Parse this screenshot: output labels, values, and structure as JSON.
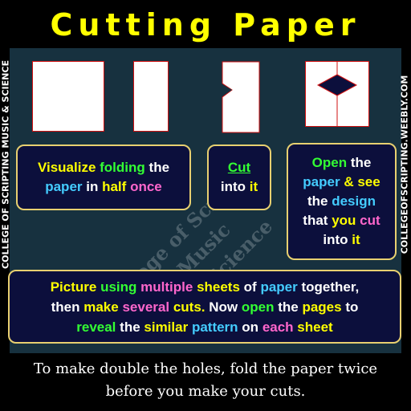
{
  "title": "Cutting Paper",
  "side_left": "COLLEGE OF SCRIPTING MUSIC & SCIENCE",
  "side_right": "COLLEGEOFSCRIPTING.WEEBLY.COM",
  "watermark": {
    "line1": "College of Scripting Music",
    "line2": "and Science"
  },
  "step1": {
    "w1": "Visualize",
    "w2": "folding",
    "w3": "the",
    "w4": "paper",
    "w5": "in",
    "w6": "half",
    "w7": "once"
  },
  "step2": {
    "w1": "Cut",
    "w2": "into",
    "w3": "it"
  },
  "step3": {
    "w1": "Open",
    "w2": "the",
    "w3": "paper",
    "w4": "&",
    "w5": "see",
    "w6": "the",
    "w7": "design",
    "w8": "that",
    "w9": "you",
    "w10": "cut",
    "w11": "into",
    "w12": "it"
  },
  "step4": {
    "w1": "Picture",
    "w2": "using",
    "w3": "multiple",
    "w4": "sheets",
    "w5": "of",
    "w6": "paper",
    "w7": "together,",
    "w8": "then",
    "w9": "make",
    "w10": "several",
    "w11": "cuts.",
    "w12": "Now",
    "w13": "open",
    "w14": "the",
    "w15": "pages",
    "w16": "to",
    "w17": "reveal",
    "w18": "the",
    "w19": "similar",
    "w20": "pattern",
    "w21": "on",
    "w22": "each",
    "w23": "sheet"
  },
  "caption": {
    "line1": "To make double the holes, fold the paper twice",
    "line2": "before you make your cuts."
  },
  "colors": {
    "title": "#ffff00",
    "panel": "#17313f",
    "box_bg": "#0c0f3c",
    "box_border": "#e8d070",
    "paper_border": "#d21010"
  }
}
